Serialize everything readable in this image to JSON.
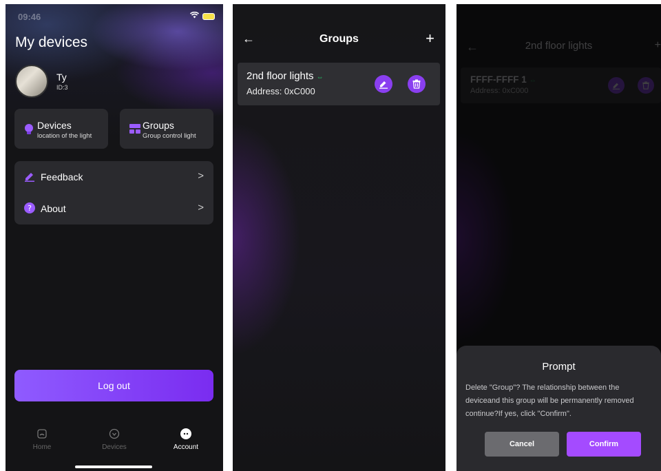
{
  "screen1": {
    "status_time": "09:46",
    "title": "My devices",
    "user": {
      "name": "Ty",
      "id": "ID:3"
    },
    "cards": [
      {
        "title": "Devices",
        "subtitle": "location of the light"
      },
      {
        "title": "Groups",
        "subtitle": "Group control light"
      }
    ],
    "menu": [
      {
        "label": "Feedback",
        "chevron": ">"
      },
      {
        "label": "About",
        "chevron": ">"
      }
    ],
    "logout_label": "Log out",
    "tabs": [
      {
        "label": "Home",
        "active": false
      },
      {
        "label": "Devices",
        "active": false
      },
      {
        "label": "Account",
        "active": true
      }
    ]
  },
  "screen2": {
    "nav": {
      "back": "←",
      "title": "Groups",
      "add": "+"
    },
    "groups": [
      {
        "name": "2nd floor lights",
        "address": "Address: 0xC000"
      }
    ]
  },
  "screen3": {
    "nav": {
      "back": "←",
      "title": "2nd floor lights",
      "add": "+"
    },
    "item": {
      "name": "FFFF-FFFF 1",
      "address": "Address: 0xC000"
    },
    "dialog": {
      "title": "Prompt",
      "lines": [
        "Delete \"Group\"? The relationship between the",
        "deviceand this group will be permanently removed",
        "continue?If yes, click \"Confirm\"."
      ],
      "cancel_label": "Cancel",
      "confirm_label": "Confirm"
    }
  },
  "colors": {
    "accent": "#8a3ff0",
    "confirm": "#a44bff",
    "link": "#25c464",
    "card": "#2a2a2e"
  }
}
